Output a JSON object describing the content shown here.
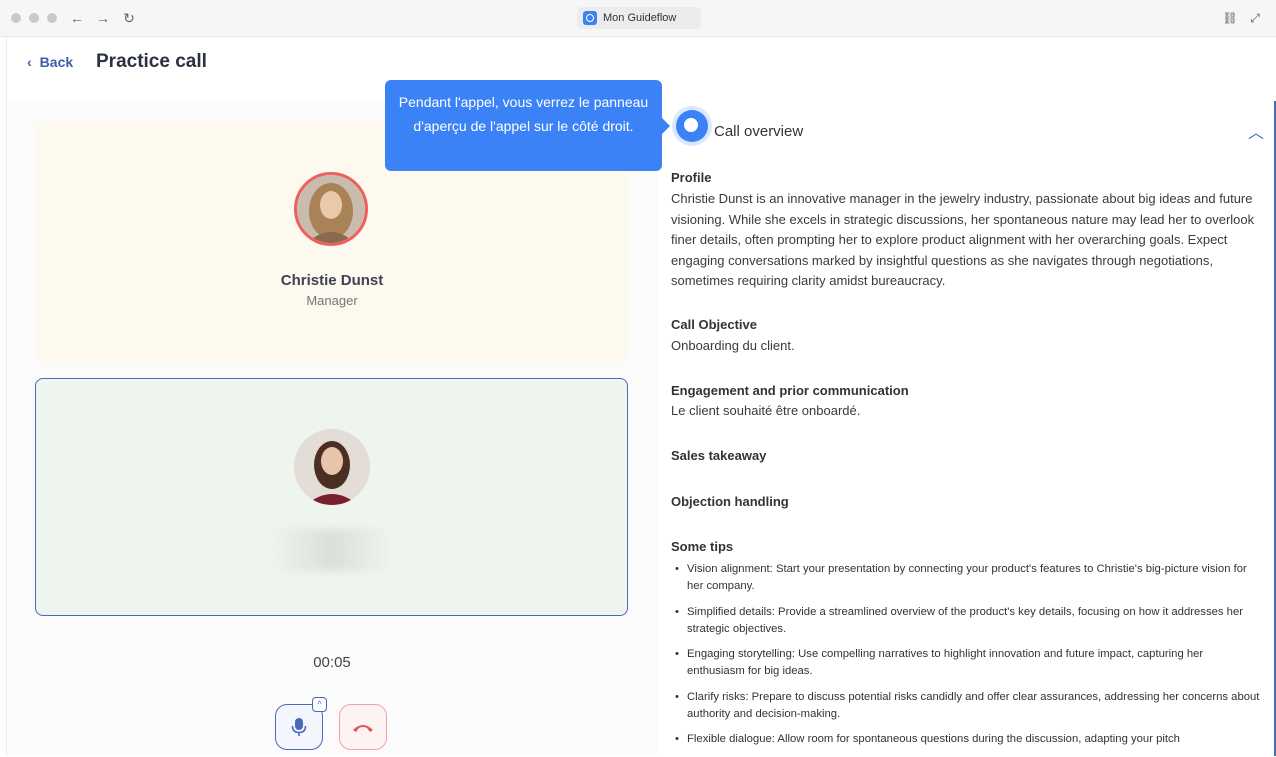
{
  "browser": {
    "tab_title": "Mon Guideflow",
    "back_glyph": "←",
    "forward_glyph": "→",
    "reload_glyph": "↻",
    "link_glyph": "⛓",
    "expand_glyph": "⤢"
  },
  "header": {
    "back_label": "Back",
    "title": "Practice call"
  },
  "call": {
    "prospect_name": "Christie Dunst",
    "prospect_role": "Manager",
    "timer": "00:05"
  },
  "tooltip": {
    "text": "Pendant l'appel, vous verrez le panneau d'aperçu de l'appel sur le côté droit."
  },
  "overview": {
    "title": "Call overview",
    "profile_heading": "Profile",
    "profile_text": "Christie Dunst is an innovative manager in the jewelry industry, passionate about big ideas and future visioning. While she excels in strategic discussions, her spontaneous nature may lead her to overlook finer details, often prompting her to explore product alignment with her overarching goals. Expect engaging conversations marked by insightful questions as she navigates through negotiations, sometimes requiring clarity amidst bureaucracy.",
    "objective_heading": "Call Objective",
    "objective_text": "Onboarding du client.",
    "engagement_heading": "Engagement and prior communication",
    "engagement_text": "Le client souhaité être onboardé.",
    "takeaway_heading": "Sales takeaway",
    "objection_heading": "Objection handling",
    "tips_heading": "Some tips",
    "tips": [
      "Vision alignment: Start your presentation by connecting your product's features to Christie's big-picture vision for her company.",
      "Simplified details: Provide a streamlined overview of the product's key details, focusing on how it addresses her strategic objectives.",
      "Engaging storytelling: Use compelling narratives to highlight innovation and future impact, capturing her enthusiasm for big ideas.",
      "Clarify risks: Prepare to discuss potential risks candidly and offer clear assurances, addressing her concerns about authority and decision-making.",
      "Flexible dialogue: Allow room for spontaneous questions during the discussion, adapting your pitch"
    ]
  },
  "colors": {
    "accent": "#3b82f6",
    "brand_blue": "#4a69b8",
    "danger": "#ef5f5f",
    "prospect_tile_bg": "#fdf9ee",
    "user_tile_bg": "#eef5ee"
  },
  "icons": [
    "back-chevron-icon",
    "microphone-icon",
    "phone-hangup-icon",
    "chevron-up-icon",
    "call-overview-icon"
  ]
}
